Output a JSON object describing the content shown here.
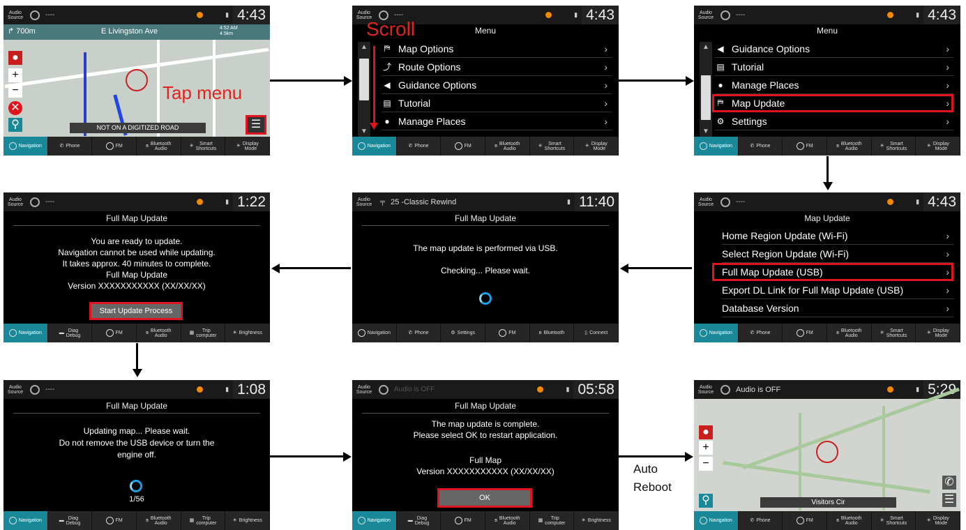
{
  "status": {
    "audio_source": "Audio\nSource",
    "dash": "----",
    "audio_off": "Audio is OFF",
    "station": "25 -Classic Rewind"
  },
  "clocks": {
    "s1": "4:43",
    "s2": "4:43",
    "s3": "4:43",
    "s4": "1:22",
    "s5": "11:40",
    "s6": "4:43",
    "s7": "1:08",
    "s8": "05:58",
    "s9": "5:29"
  },
  "nav": {
    "distance": "700m",
    "street": "E Livingston Ave",
    "eta": "4:52 AM",
    "remaining": "4.5km",
    "banner": "NOT ON A DIGITIZED ROAD",
    "place": "Visitors Cir"
  },
  "annotations": {
    "tap_menu": "Tap menu",
    "scroll": "Scroll",
    "auto": "Auto",
    "reboot": "Reboot"
  },
  "menu": {
    "title": "Menu",
    "items_a": [
      {
        "icon": "map-options-icon",
        "label": "Map Options"
      },
      {
        "icon": "route-icon",
        "label": "Route Options"
      },
      {
        "icon": "speaker-icon",
        "label": "Guidance Options"
      },
      {
        "icon": "book-icon",
        "label": "Tutorial"
      },
      {
        "icon": "person-icon",
        "label": "Manage Places"
      }
    ],
    "items_b": [
      {
        "icon": "speaker-icon",
        "label": "Guidance Options"
      },
      {
        "icon": "book-icon",
        "label": "Tutorial"
      },
      {
        "icon": "person-icon",
        "label": "Manage Places"
      },
      {
        "icon": "map-update-icon",
        "label": "Map Update"
      },
      {
        "icon": "gear-icon",
        "label": "Settings"
      }
    ]
  },
  "map_update": {
    "title": "Map Update",
    "items": [
      "Home Region Update (Wi-Fi)",
      "Select Region Update (Wi-Fi)",
      "Full Map Update (USB)",
      "Export DL Link for Full Map Update (USB)",
      "Database Version"
    ]
  },
  "full_update": {
    "title": "Full Map Update",
    "usb_msg": "The map update is performed via USB.",
    "checking": "Checking... Please wait.",
    "ready": [
      "You are ready to update.",
      "Navigation cannot be used while updating.",
      "It takes approx. 40 minutes to complete.",
      "Full Map Update",
      "Version XXXXXXXXXXX (XX/XX/XX)"
    ],
    "start_btn": "Start Update Process",
    "updating": [
      "Updating map... Please wait.",
      "Do not remove the USB device or turn the",
      "engine off."
    ],
    "progress": "1/56",
    "complete": [
      "The map update is complete.",
      "Please select OK to restart application."
    ],
    "full_map": "Full Map",
    "version2": "Version XXXXXXXXXXX (XX/XX/XX)",
    "ok": "OK"
  },
  "bottom_bars": {
    "std": [
      "Navigation",
      "Phone",
      "FM",
      "Bluetooth\nAudio",
      "Smart\nShortcuts",
      "Display\nMode"
    ],
    "diag": [
      "Navigation",
      "Diag\nDebug",
      "FM",
      "Bluetooth\nAudio",
      "Trip\ncomputer",
      "Brightness"
    ],
    "radio": [
      "Navigation",
      "Phone",
      "Settings",
      "FM",
      "Bluetooth",
      "Connect"
    ]
  },
  "colors": {
    "highlight": "#e0131e",
    "active_tab": "#19899a",
    "status_dot": "#f28a00",
    "spinner": "#1aa0e8"
  }
}
